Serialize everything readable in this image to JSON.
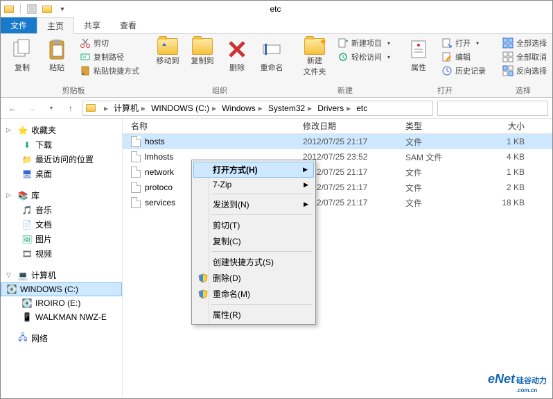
{
  "window": {
    "title": "etc"
  },
  "tabs": {
    "file": "文件",
    "home": "主页",
    "share": "共享",
    "view": "查看"
  },
  "ribbon": {
    "clipboard": {
      "copy": "复制",
      "paste": "粘贴",
      "cut": "剪切",
      "copypath": "复制路径",
      "pasteshortcut": "粘贴快捷方式",
      "label": "剪贴板"
    },
    "organize": {
      "moveto": "移动到",
      "copyto": "复制到",
      "delete": "删除",
      "rename": "重命名",
      "label": "组织"
    },
    "new": {
      "newfolder": "新建\n文件夹",
      "newitem": "新建项目",
      "easyaccess": "轻松访问",
      "label": "新建"
    },
    "open": {
      "properties": "属性",
      "open": "打开",
      "edit": "编辑",
      "history": "历史记录",
      "label": "打开"
    },
    "select": {
      "selectall": "全部选择",
      "selectnone": "全部取消",
      "invert": "反向选择",
      "label": "选择"
    }
  },
  "breadcrumb": [
    "计算机",
    "WINDOWS (C:)",
    "Windows",
    "System32",
    "Drivers",
    "etc"
  ],
  "search_placeholder": "",
  "columns": {
    "name": "名称",
    "date": "修改日期",
    "type": "类型",
    "size": "大小"
  },
  "files": [
    {
      "name": "hosts",
      "date": "2012/07/25 21:17",
      "type": "文件",
      "size": "1 KB",
      "selected": true
    },
    {
      "name": "lmhosts",
      "date": "2012/07/25 23:52",
      "type": "SAM 文件",
      "size": "4 KB"
    },
    {
      "name": "network",
      "date": "2012/07/25 21:17",
      "type": "文件",
      "size": "1 KB"
    },
    {
      "name": "protoco",
      "date": "2012/07/25 21:17",
      "type": "文件",
      "size": "2 KB"
    },
    {
      "name": "services",
      "date": "2012/07/25 21:17",
      "type": "文件",
      "size": "18 KB"
    }
  ],
  "nav": {
    "favorites": {
      "label": "收藏夹",
      "items": [
        "下载",
        "最近访问的位置",
        "桌面"
      ]
    },
    "libraries": {
      "label": "库",
      "items": [
        "音乐",
        "文档",
        "图片",
        "视频"
      ]
    },
    "computer": {
      "label": "计算机",
      "items": [
        "WINDOWS (C:)",
        "IROIRO (E:)",
        "WALKMAN NWZ-E"
      ]
    },
    "network": {
      "label": "网络"
    }
  },
  "context": {
    "openwith": "打开方式(H)",
    "sevenzip": "7-Zip",
    "sendto": "发送到(N)",
    "cut": "剪切(T)",
    "copy": "复制(C)",
    "shortcut": "创建快捷方式(S)",
    "delete": "删除(D)",
    "rename": "重命名(M)",
    "properties": "属性(R)"
  },
  "logo": {
    "brand": "eNet",
    "suffix": "硅谷动力",
    "domain": ".com.cn"
  }
}
